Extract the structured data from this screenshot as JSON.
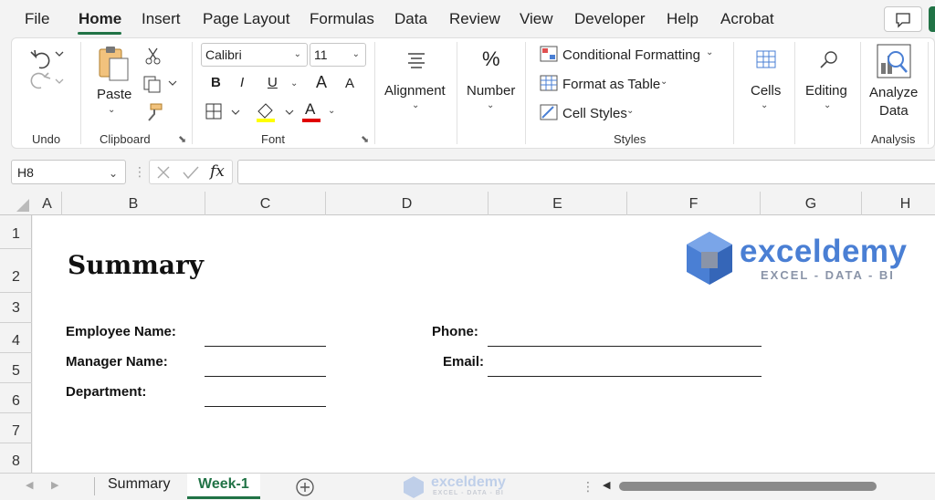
{
  "menu": {
    "tabs": [
      "File",
      "Home",
      "Insert",
      "Page Layout",
      "Formulas",
      "Data",
      "Review",
      "View",
      "Developer",
      "Help",
      "Acrobat"
    ],
    "active": "Home"
  },
  "ribbon": {
    "undo_group": "Undo",
    "clipboard": {
      "paste": "Paste",
      "group": "Clipboard"
    },
    "font": {
      "family": "Calibri",
      "size": "11",
      "bold": "B",
      "italic": "I",
      "underline": "U",
      "grow": "A",
      "shrink": "A",
      "color_a": "A",
      "group": "Font"
    },
    "alignment": "Alignment",
    "number": {
      "symbol": "%",
      "label": "Number"
    },
    "styles": {
      "conditional": "Conditional Formatting",
      "format_table": "Format as Table",
      "cell_styles": "Cell Styles",
      "group": "Styles"
    },
    "cells": "Cells",
    "editing": "Editing",
    "analyze": {
      "line1": "Analyze",
      "line2": "Data",
      "group": "Analysis"
    }
  },
  "formula_bar": {
    "name_box": "H8",
    "fx": "fx",
    "value": ""
  },
  "columns": [
    "A",
    "B",
    "C",
    "D",
    "E",
    "F",
    "G",
    "H"
  ],
  "rows": [
    "1",
    "2",
    "3",
    "4",
    "5",
    "6",
    "7",
    "8"
  ],
  "sheet": {
    "title": "Summary",
    "labels": {
      "employee": "Employee Name:",
      "manager": "Manager Name:",
      "department": "Department:",
      "phone": "Phone:",
      "email": "Email:"
    },
    "logo": {
      "name": "exceldemy",
      "tagline": "EXCEL - DATA - BI"
    }
  },
  "sheet_tabs": [
    "Summary",
    "Week-1"
  ],
  "active_sheet": "Week-1",
  "colors": {
    "accent": "#217346",
    "logo_blue": "#4a7fd4",
    "font_color_bar": "#e00000"
  }
}
